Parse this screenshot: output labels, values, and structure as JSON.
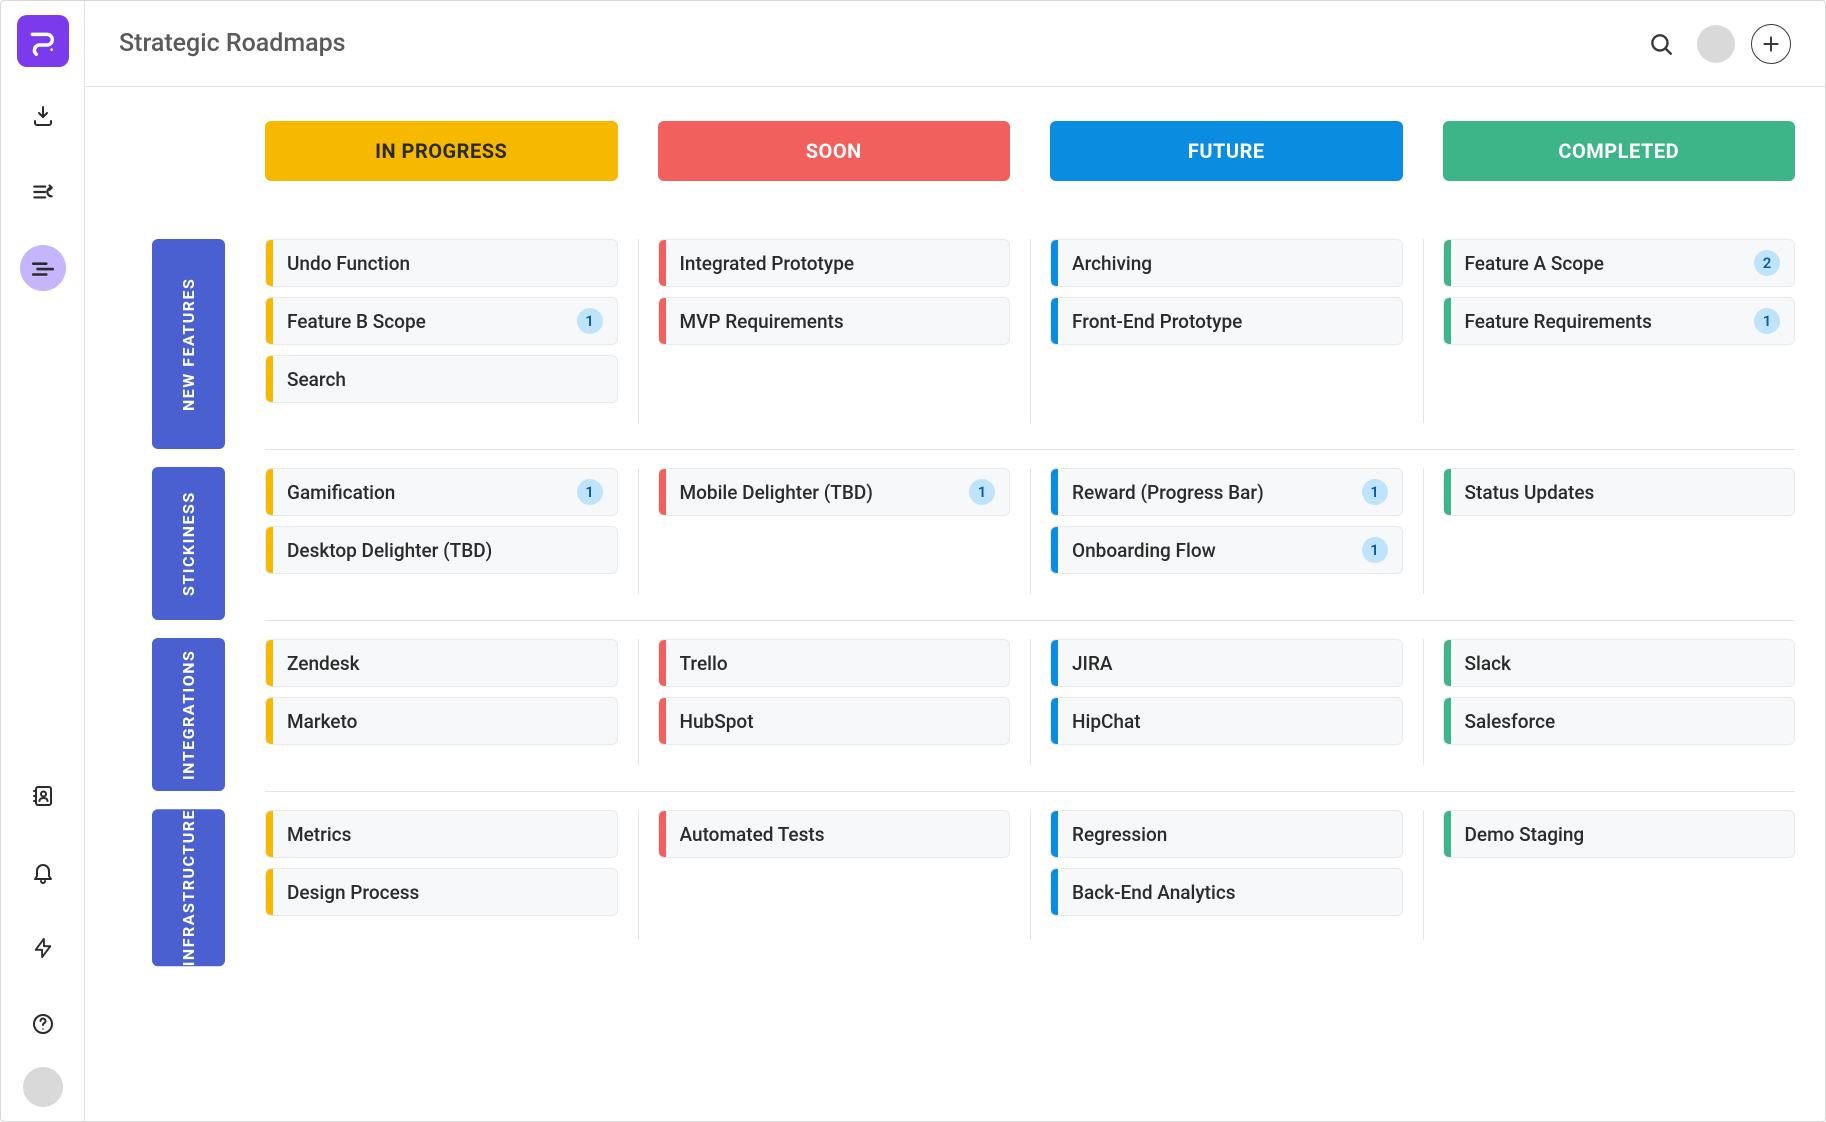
{
  "page_title": "Strategic Roadmaps",
  "columns": [
    {
      "id": "in_progress",
      "label": "IN PROGRESS",
      "color": "yellow"
    },
    {
      "id": "soon",
      "label": "SOON",
      "color": "red"
    },
    {
      "id": "future",
      "label": "FUTURE",
      "color": "blue"
    },
    {
      "id": "completed",
      "label": "COMPLETED",
      "color": "green"
    }
  ],
  "swimlanes": [
    {
      "id": "new_features",
      "label": "NEW FEATURES",
      "cells": {
        "in_progress": [
          {
            "title": "Undo Function"
          },
          {
            "title": "Feature B Scope",
            "badge": 1
          },
          {
            "title": "Search"
          }
        ],
        "soon": [
          {
            "title": "Integrated Prototype"
          },
          {
            "title": "MVP Requirements"
          }
        ],
        "future": [
          {
            "title": "Archiving"
          },
          {
            "title": "Front-End Prototype"
          }
        ],
        "completed": [
          {
            "title": "Feature A Scope",
            "badge": 2
          },
          {
            "title": "Feature Requirements",
            "badge": 1
          }
        ]
      }
    },
    {
      "id": "stickiness",
      "label": "STICKINESS",
      "cells": {
        "in_progress": [
          {
            "title": "Gamification",
            "badge": 1
          },
          {
            "title": "Desktop Delighter (TBD)"
          }
        ],
        "soon": [
          {
            "title": "Mobile Delighter (TBD)",
            "badge": 1
          }
        ],
        "future": [
          {
            "title": "Reward (Progress Bar)",
            "badge": 1
          },
          {
            "title": "Onboarding Flow",
            "badge": 1
          }
        ],
        "completed": [
          {
            "title": "Status Updates"
          }
        ]
      }
    },
    {
      "id": "integrations",
      "label": "INTEGRATIONS",
      "cells": {
        "in_progress": [
          {
            "title": "Zendesk"
          },
          {
            "title": "Marketo"
          }
        ],
        "soon": [
          {
            "title": "Trello"
          },
          {
            "title": "HubSpot"
          }
        ],
        "future": [
          {
            "title": "JIRA"
          },
          {
            "title": "HipChat"
          }
        ],
        "completed": [
          {
            "title": "Slack"
          },
          {
            "title": "Salesforce"
          }
        ]
      }
    },
    {
      "id": "infrastructure",
      "label": "INFRASTRUCTURE",
      "cells": {
        "in_progress": [
          {
            "title": "Metrics"
          },
          {
            "title": "Design Process"
          }
        ],
        "soon": [
          {
            "title": "Automated Tests"
          }
        ],
        "future": [
          {
            "title": "Regression"
          },
          {
            "title": "Back-End Analytics"
          }
        ],
        "completed": [
          {
            "title": "Demo Staging"
          }
        ]
      }
    }
  ]
}
